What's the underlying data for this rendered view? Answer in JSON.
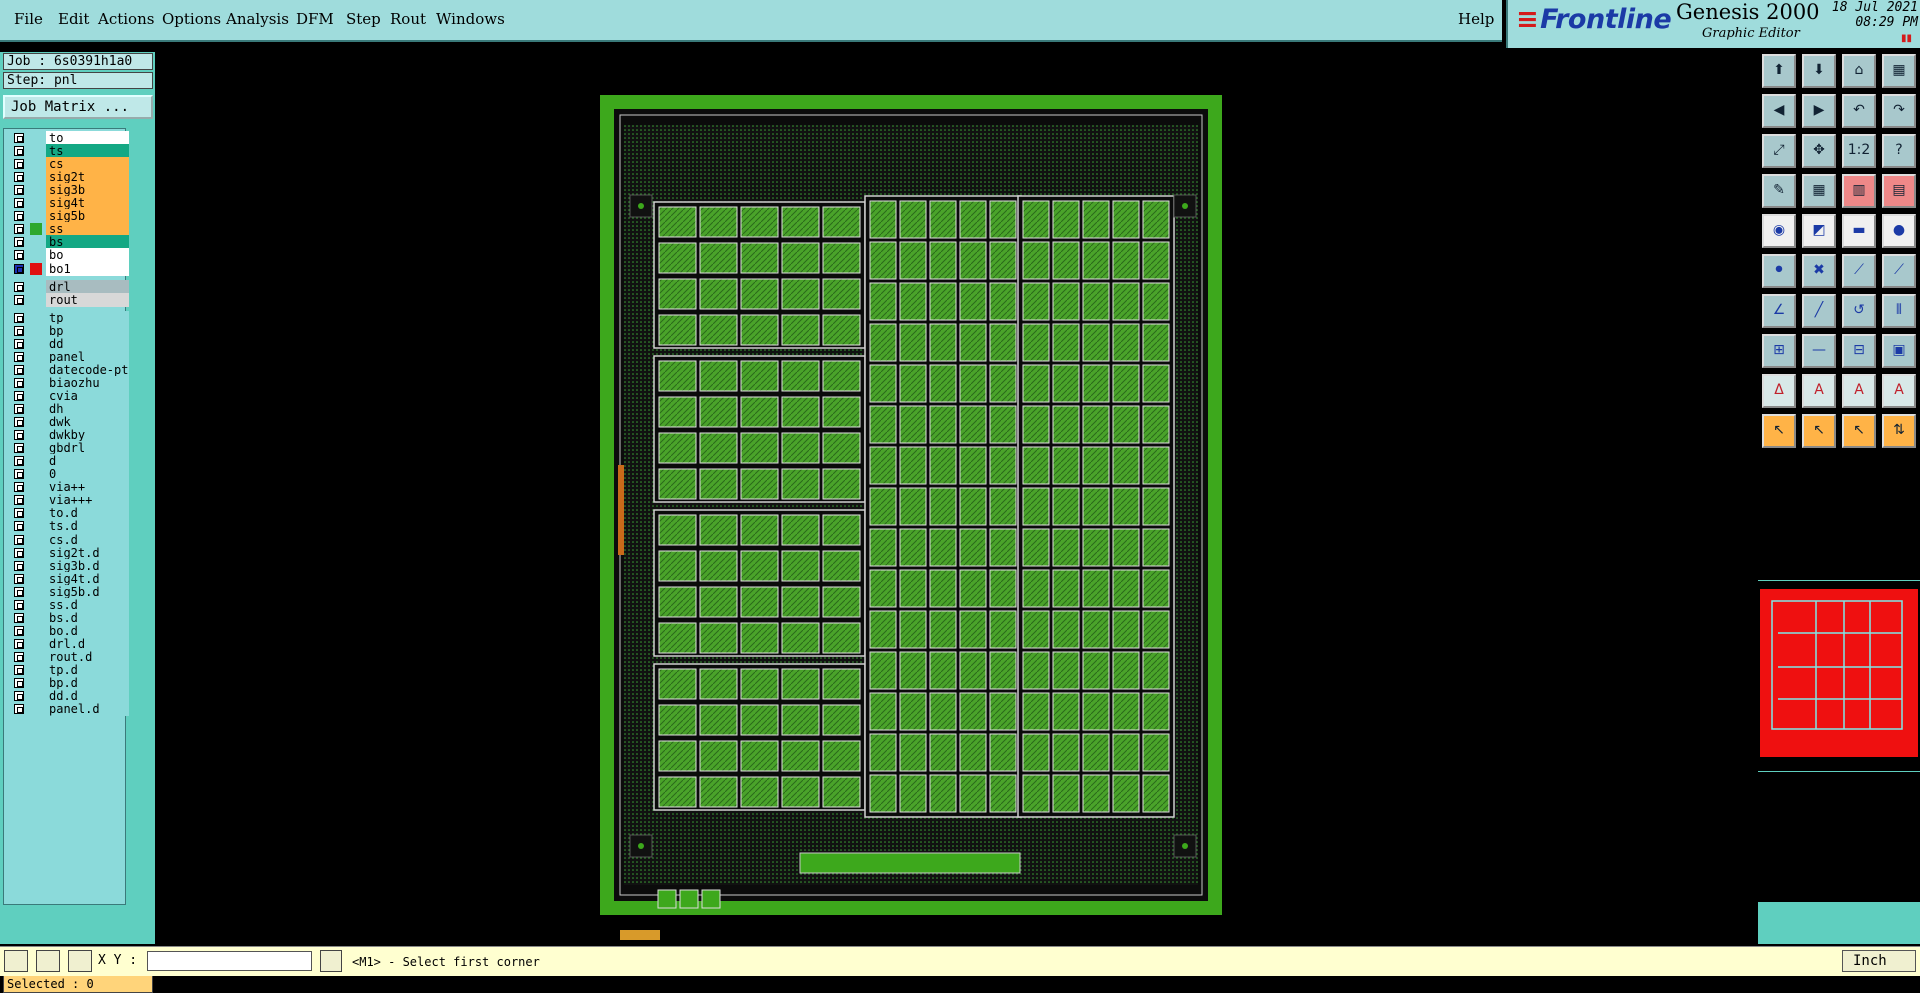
{
  "menu": {
    "items": [
      "File",
      "Edit",
      "Actions",
      "Options",
      "Analysis",
      "DFM",
      "Step",
      "Rout",
      "Windows"
    ],
    "help": "Help"
  },
  "brand": {
    "logo": "Frontline",
    "product": "Genesis 2000",
    "subtitle": "Graphic Editor",
    "date": "18 Jul 2021",
    "time": "08:29 PM"
  },
  "job": {
    "job_label": "Job : 6s0391h1a0",
    "step_label": "Step: pnl",
    "matrix_button": "Job Matrix ..."
  },
  "layers": [
    {
      "name": "to",
      "color": "#ffffff",
      "mark": ""
    },
    {
      "name": "ts",
      "color": "#14a884",
      "mark": ""
    },
    {
      "name": "cs",
      "color": "#ffb347",
      "mark": ""
    },
    {
      "name": "sig2t",
      "color": "#ffb347",
      "mark": ""
    },
    {
      "name": "sig3b",
      "color": "#ffb347",
      "mark": ""
    },
    {
      "name": "sig4t",
      "color": "#ffb347",
      "mark": ""
    },
    {
      "name": "sig5b",
      "color": "#ffb347",
      "mark": ""
    },
    {
      "name": "ss",
      "color": "#ffb347",
      "mark": "#2ea82e"
    },
    {
      "name": "bs",
      "color": "#14a884",
      "mark": ""
    },
    {
      "name": "bo",
      "color": "#ffffff",
      "mark": ""
    },
    {
      "name": "bo1",
      "color": "#ffffff",
      "mark": "#e01010",
      "active": true
    },
    {
      "name": "drl",
      "color": "#a8bcc0",
      "mark": ""
    },
    {
      "name": "rout",
      "color": "#d8d8d8",
      "mark": ""
    },
    {
      "name": "tp",
      "color": "#8bdada",
      "mark": ""
    },
    {
      "name": "bp",
      "color": "#8bdada",
      "mark": ""
    },
    {
      "name": "dd",
      "color": "#8bdada",
      "mark": ""
    },
    {
      "name": "panel",
      "color": "#8bdada",
      "mark": ""
    },
    {
      "name": "datecode-pt",
      "color": "#8bdada",
      "mark": ""
    },
    {
      "name": "biaozhu",
      "color": "#8bdada",
      "mark": ""
    },
    {
      "name": "cvia",
      "color": "#8bdada",
      "mark": ""
    },
    {
      "name": "dh",
      "color": "#8bdada",
      "mark": ""
    },
    {
      "name": "dwk",
      "color": "#8bdada",
      "mark": ""
    },
    {
      "name": "dwkby",
      "color": "#8bdada",
      "mark": ""
    },
    {
      "name": "gbdrl",
      "color": "#8bdada",
      "mark": ""
    },
    {
      "name": "d",
      "color": "#8bdada",
      "mark": ""
    },
    {
      "name": "0",
      "color": "#8bdada",
      "mark": ""
    },
    {
      "name": "via++",
      "color": "#8bdada",
      "mark": ""
    },
    {
      "name": "via+++",
      "color": "#8bdada",
      "mark": ""
    },
    {
      "name": "to.d",
      "color": "#8bdada",
      "mark": ""
    },
    {
      "name": "ts.d",
      "color": "#8bdada",
      "mark": ""
    },
    {
      "name": "cs.d",
      "color": "#8bdada",
      "mark": ""
    },
    {
      "name": "sig2t.d",
      "color": "#8bdada",
      "mark": ""
    },
    {
      "name": "sig3b.d",
      "color": "#8bdada",
      "mark": ""
    },
    {
      "name": "sig4t.d",
      "color": "#8bdada",
      "mark": ""
    },
    {
      "name": "sig5b.d",
      "color": "#8bdada",
      "mark": ""
    },
    {
      "name": "ss.d",
      "color": "#8bdada",
      "mark": ""
    },
    {
      "name": "bs.d",
      "color": "#8bdada",
      "mark": ""
    },
    {
      "name": "bo.d",
      "color": "#8bdada",
      "mark": ""
    },
    {
      "name": "drl.d",
      "color": "#8bdada",
      "mark": ""
    },
    {
      "name": "rout.d",
      "color": "#8bdada",
      "mark": ""
    },
    {
      "name": "tp.d",
      "color": "#8bdada",
      "mark": ""
    },
    {
      "name": "bp.d",
      "color": "#8bdada",
      "mark": ""
    },
    {
      "name": "dd.d",
      "color": "#8bdada",
      "mark": ""
    },
    {
      "name": "panel.d",
      "color": "#8bdada",
      "mark": ""
    }
  ],
  "selected": "Selected : 0",
  "status": {
    "xy_label": "X Y :",
    "xy_value": "",
    "prompt": "<M1> - Select first corner",
    "units": "Inch"
  },
  "toolbar": {
    "icons": [
      "save-icon",
      "open-icon",
      "home-icon",
      "window-split-icon",
      "step-left-icon",
      "step-right-icon",
      "undo-icon",
      "redo-icon",
      "zoom-fit-icon",
      "zoom-center-icon",
      "ratio-icon",
      "help-icon",
      "snap-icon",
      "grid-icon",
      "layer-colors-icon",
      "layer-settings-icon",
      "select-dot-icon",
      "rectangle-icon",
      "ruler-icon",
      "circle-icon",
      "move-icon",
      "delete-icon",
      "connect-icon",
      "arc-icon",
      "angle-icon",
      "line-icon",
      "rotate-icon",
      "mirror-icon",
      "copy-icon",
      "cut-icon",
      "measure-icon",
      "layer-icon",
      "text-icon",
      "text-bold-icon",
      "text-frame-icon",
      "text-align-icon",
      "pointer-icon",
      "pointer-select-icon",
      "pointer-circle-icon",
      "pointer-step-icon"
    ]
  },
  "colors": {
    "background": "#000000",
    "panel": "#9fdcdc",
    "accent": "#5fcfbf",
    "board_green": "#3da81c"
  }
}
